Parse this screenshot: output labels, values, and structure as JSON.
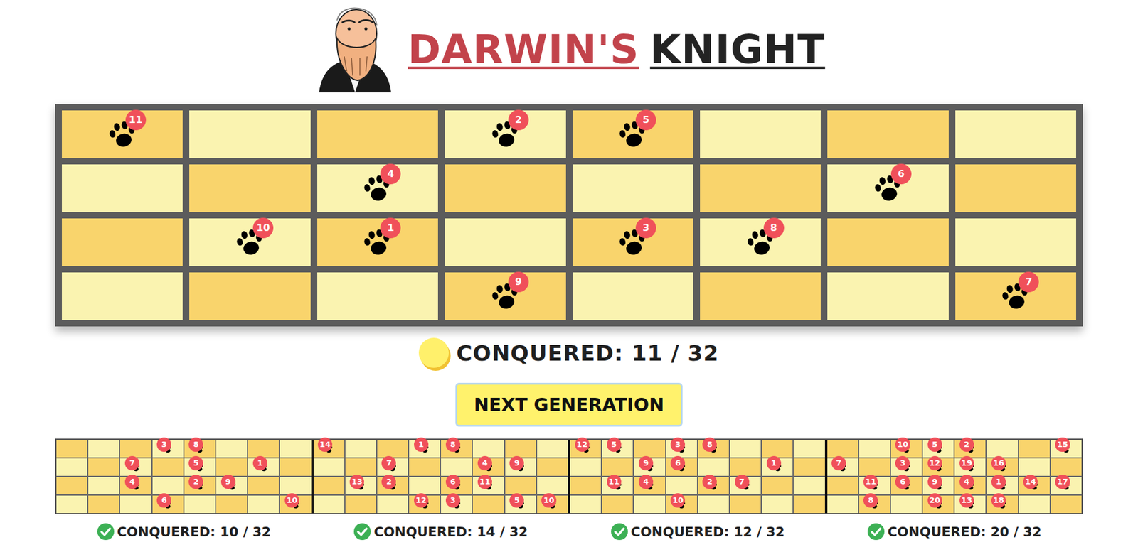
{
  "header": {
    "title_primary": "DARWIN'S",
    "title_secondary": "KNIGHT"
  },
  "board": {
    "rows": [
      [
        "11",
        "",
        "",
        "2",
        "5",
        "",
        "",
        ""
      ],
      [
        "",
        "",
        "4",
        "",
        "",
        "",
        "6",
        ""
      ],
      [
        "",
        "10",
        "1",
        "",
        "3",
        "8",
        "",
        ""
      ],
      [
        "",
        "",
        "",
        "9",
        "",
        "",
        "",
        "7"
      ]
    ]
  },
  "counter": {
    "label": "CONQUERED: 11 / 32"
  },
  "button": {
    "label": "NEXT GENERATION"
  },
  "history": [
    {
      "label": "CONQUERED: 10 / 32",
      "done": true,
      "rows": [
        [
          "",
          "",
          "",
          "3",
          "8",
          "",
          "",
          ""
        ],
        [
          "",
          "",
          "7",
          "",
          "5",
          "",
          "1",
          ""
        ],
        [
          "",
          "",
          "4",
          "",
          "2",
          "9",
          "",
          ""
        ],
        [
          "",
          "",
          "",
          "6",
          "",
          "",
          "",
          "10"
        ]
      ]
    },
    {
      "label": "CONQUERED: 14 / 32",
      "done": true,
      "rows": [
        [
          "14",
          "",
          "",
          "1",
          "8",
          "",
          "",
          ""
        ],
        [
          "",
          "",
          "7",
          "",
          "",
          "4",
          "9",
          ""
        ],
        [
          "",
          "13",
          "2",
          "",
          "6",
          "11",
          "",
          ""
        ],
        [
          "",
          "",
          "",
          "12",
          "3",
          "",
          "5",
          "10"
        ]
      ]
    },
    {
      "label": "CONQUERED: 12 / 32",
      "done": true,
      "rows": [
        [
          "12",
          "5",
          "",
          "3",
          "8",
          "",
          "",
          ""
        ],
        [
          "",
          "",
          "9",
          "6",
          "",
          "",
          "1",
          ""
        ],
        [
          "",
          "11",
          "4",
          "",
          "2",
          "7",
          "",
          ""
        ],
        [
          "",
          "",
          "",
          "10",
          "",
          "",
          "",
          ""
        ]
      ]
    },
    {
      "label": "CONQUERED: 20 / 32",
      "done": true,
      "rows": [
        [
          "",
          "",
          "10",
          "5",
          "2",
          "",
          "",
          "15"
        ],
        [
          "7",
          "",
          "3",
          "12",
          "19",
          "16",
          "",
          ""
        ],
        [
          "",
          "11",
          "6",
          "9",
          "4",
          "1",
          "14",
          "17"
        ],
        [
          "",
          "8",
          "",
          "20",
          "13",
          "18",
          "",
          ""
        ]
      ]
    }
  ]
}
